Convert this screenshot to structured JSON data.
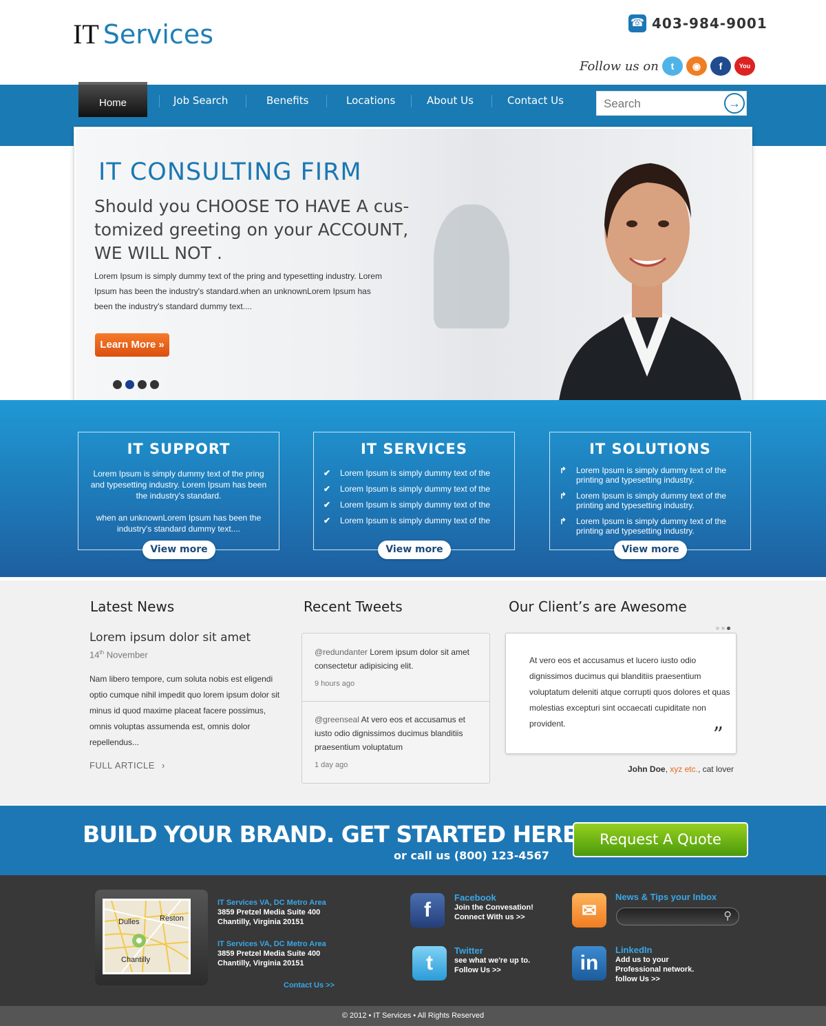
{
  "header": {
    "logo_it": "IT",
    "logo_services": "Services",
    "phone": "403-984-9001",
    "follow": "Follow us on",
    "social": [
      {
        "name": "twitter-icon",
        "glyph": "t",
        "color": "#4fb3e8"
      },
      {
        "name": "rss-icon",
        "glyph": "◉",
        "color": "#f07d22"
      },
      {
        "name": "facebook-icon",
        "glyph": "f",
        "color": "#214b8f"
      },
      {
        "name": "youtube-icon",
        "glyph": "▶",
        "color": "#d22"
      }
    ]
  },
  "nav": {
    "items": [
      "Home",
      "Job Search",
      "Benefits",
      "Locations",
      "About Us",
      "Contact Us"
    ],
    "search_placeholder": "Search"
  },
  "hero": {
    "title": "IT CONSULTING FIRM",
    "subtitle": "Should you CHOOSE TO HAVE A cus-tomized greeting on your ACCOUNT, WE WILL NOT .",
    "text": "Lorem Ipsum is simply dummy text of the pring and typesetting industry. Lorem Ipsum has been the industry's standard.when an unknownLorem Ipsum has been the industry's standard dummy text....",
    "button": "Learn More »",
    "active_slide": 2
  },
  "boxes": {
    "support": {
      "title": "IT SUPPORT",
      "p1": "Lorem Ipsum is simply dummy text of the pring and typesetting industry. Lorem Ipsum has been the industry's standard.",
      "p2": "when an unknownLorem Ipsum has been the industry's standard dummy text....",
      "button": "View more"
    },
    "services": {
      "title": "IT SERVICES",
      "items": [
        "Lorem Ipsum is simply dummy text of the",
        "Lorem Ipsum is simply dummy text of the",
        "Lorem Ipsum is simply dummy text of the",
        "Lorem Ipsum is simply dummy text of the"
      ],
      "button": "View more"
    },
    "solutions": {
      "title": "IT SOLUTIONS",
      "items": [
        "Lorem Ipsum is simply dummy text of the printing and typesetting industry.",
        "Lorem Ipsum is simply dummy text of the printing and typesetting industry.",
        "Lorem Ipsum is simply dummy text of the printing and typesetting industry."
      ],
      "button": "View more"
    }
  },
  "news": {
    "title": "Latest News",
    "headline": "Lorem ipsum dolor sit amet",
    "date_day": "14",
    "date_sup": "th",
    "date_month": "November",
    "body": "Nam libero tempore, cum soluta nobis est eligendi optio cumque nihil impedit quo lorem ipsum dolor sit  minus id quod maxime placeat facere possimus, omnis voluptas assumenda est, omnis dolor repellendus...",
    "more": "FULL ARTICLE"
  },
  "tweets": {
    "title": "Recent Tweets",
    "items": [
      {
        "handle": "@redundanter",
        "text": "Lorem ipsum dolor sit amet consectetur adipisicing elit.",
        "time": "9 hours ago"
      },
      {
        "handle": "@greenseal",
        "text": "At vero eos et accusamus et iusto odio dignissimos ducimus blanditiis praesentium voluptatum",
        "time": "1 day ago"
      }
    ]
  },
  "clients": {
    "title": "Our Client’s are Awesome",
    "quote": "At vero eos et accusamus et lucero iusto odio dignissimos ducimus qui blanditiis praesentium voluptatum deleniti atque corrupti quos dolores et quas molestias excepturi sint occaecati cupiditate non provident.",
    "mark": "”",
    "author": "John Doe",
    "org": "xyz etc.",
    "role": ", cat lover"
  },
  "cta": {
    "headline": "BUILD YOUR BRAND. GET STARTED HERE",
    "call": "or call us   (800) 123-4567",
    "button": "Request A Quote"
  },
  "footer": {
    "map_labels": [
      "Dulles",
      "Reston",
      "Chantilly"
    ],
    "addresses": [
      {
        "title": "IT Services VA, DC Metro Area",
        "line1": "3859 Pretzel Media Suite 400",
        "line2": "Chantilly, Virginia 20151"
      },
      {
        "title": "IT Services VA, DC Metro Area",
        "line1": "3859 Pretzel Media Suite 400",
        "line2": "Chantilly, Virginia 20151"
      }
    ],
    "contact": "Contact Us >>",
    "facebook": {
      "title": "Facebook",
      "l1": "Join the Convesation!",
      "l2": "Connect With us >>"
    },
    "twitter": {
      "title": "Twitter",
      "l1": "see what we're up to.",
      "l2": "Follow Us >>"
    },
    "newsletter": {
      "title": "News & Tips your Inbox"
    },
    "linkedin": {
      "title": "LinkedIn",
      "l1": "Add us to your",
      "l2": "Professional network.",
      "l3": "follow Us >>"
    },
    "copyright": "© 2012 • IT Services • All Rights Reserved"
  },
  "colors": {
    "brand": "#1a7ab3",
    "orange": "#e8641d",
    "green": "#6ab816"
  }
}
